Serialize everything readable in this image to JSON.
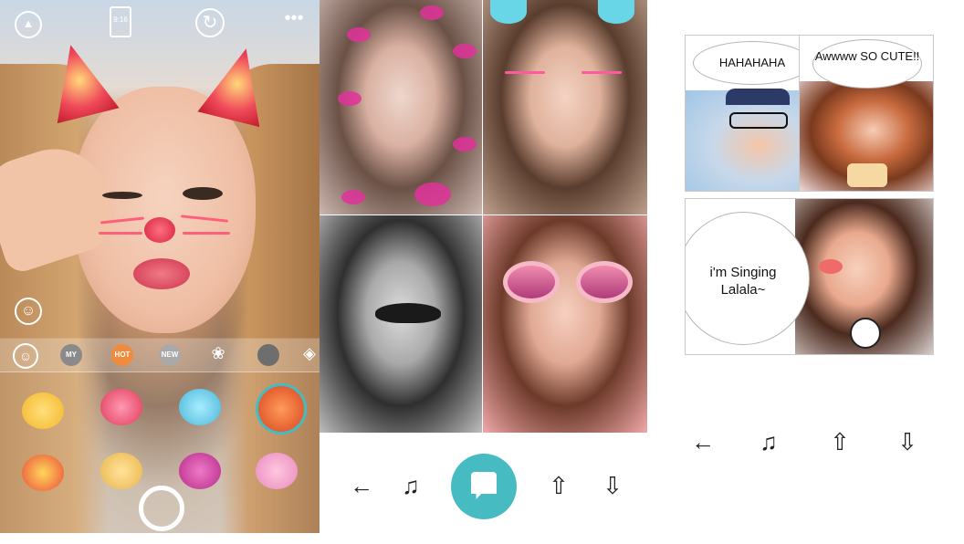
{
  "camera": {
    "top_icons": [
      "gallery-icon",
      "ratio-icon",
      "switch-camera-icon",
      "more-icon"
    ],
    "ratio_label": "9:16",
    "categories": [
      {
        "label": "MY",
        "color": "#8a8a8a"
      },
      {
        "label": "HOT",
        "color": "#f08a3c"
      },
      {
        "label": "NEW",
        "color": "#a9a9a9"
      }
    ]
  },
  "collage": {
    "toolbar_icons": [
      "back-arrow-icon",
      "music-note-icon",
      "share-icon",
      "download-icon"
    ],
    "fab_icon": "comic-bubble-icon",
    "accent": "#46bcc2"
  },
  "comic": {
    "bubbles": [
      "HAHAHAHA",
      "Awwww SO CUTE!!",
      "i'm Singing Lalala~"
    ],
    "toolbar_icons": [
      "back-arrow-icon",
      "music-note-icon",
      "share-icon",
      "download-icon"
    ]
  }
}
